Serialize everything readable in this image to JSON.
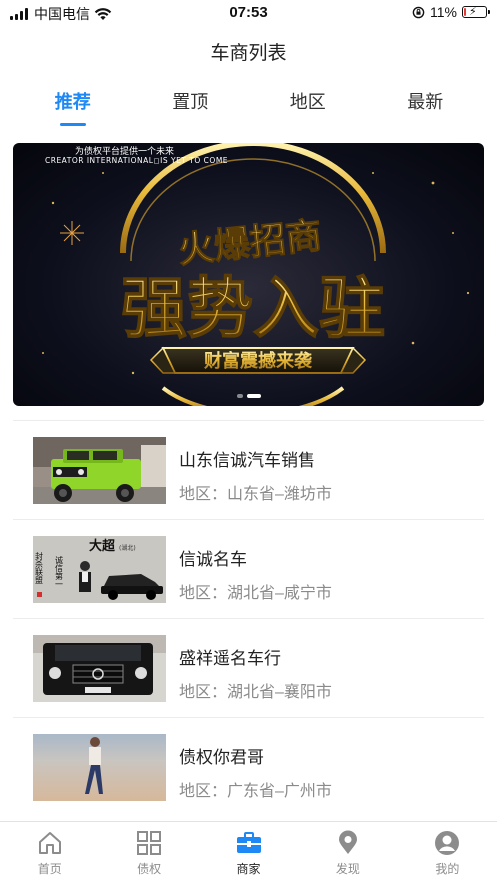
{
  "status_bar": {
    "carrier": "中国电信",
    "time": "07:53",
    "battery": "11%",
    "battery_level": 0.11
  },
  "nav": {
    "title": "车商列表"
  },
  "tabs": [
    {
      "label": "推荐",
      "active": true
    },
    {
      "label": "置顶",
      "active": false
    },
    {
      "label": "地区",
      "active": false
    },
    {
      "label": "最新",
      "active": false
    }
  ],
  "banner": {
    "top_line_cn": "为债权平台提供一个未来",
    "top_line_en": "CREATOR INTERNATIONAL◻IS YET TO COME",
    "headline_small": "火爆招商",
    "headline_big": "强势入驻",
    "ribbon": "财富震撼来袭",
    "slide_count": 2,
    "active_slide": 1
  },
  "dealers": [
    {
      "name": "山东信诚汽车销售",
      "region_label": "地区：",
      "region": "山东省–潍坊市",
      "thumb": "green-jeep"
    },
    {
      "name": "信诚名车",
      "region_label": "地区：",
      "region": "湖北省–咸宁市",
      "thumb": "sign-board",
      "thumb_text": {
        "big": "大超",
        "small": "(湖北)",
        "left": "封杀联盟",
        "right": "诚信第一"
      }
    },
    {
      "name": "盛祥遥名车行",
      "region_label": "地区：",
      "region": "湖北省–襄阳市",
      "thumb": "black-suv"
    },
    {
      "name": "债权你君哥",
      "region_label": "地区：",
      "region": "广东省–广州市",
      "thumb": "beach-person"
    }
  ],
  "tabbar": [
    {
      "label": "首页",
      "icon": "home-icon",
      "active": false
    },
    {
      "label": "债权",
      "icon": "grid-icon",
      "active": false
    },
    {
      "label": "商家",
      "icon": "briefcase-icon",
      "active": true
    },
    {
      "label": "发现",
      "icon": "location-pin-icon",
      "active": false
    },
    {
      "label": "我的",
      "icon": "user-icon",
      "active": false
    }
  ],
  "colors": {
    "accent": "#1e88f5",
    "gold": "#e8b93a",
    "muted_text": "#8a8a8a"
  }
}
